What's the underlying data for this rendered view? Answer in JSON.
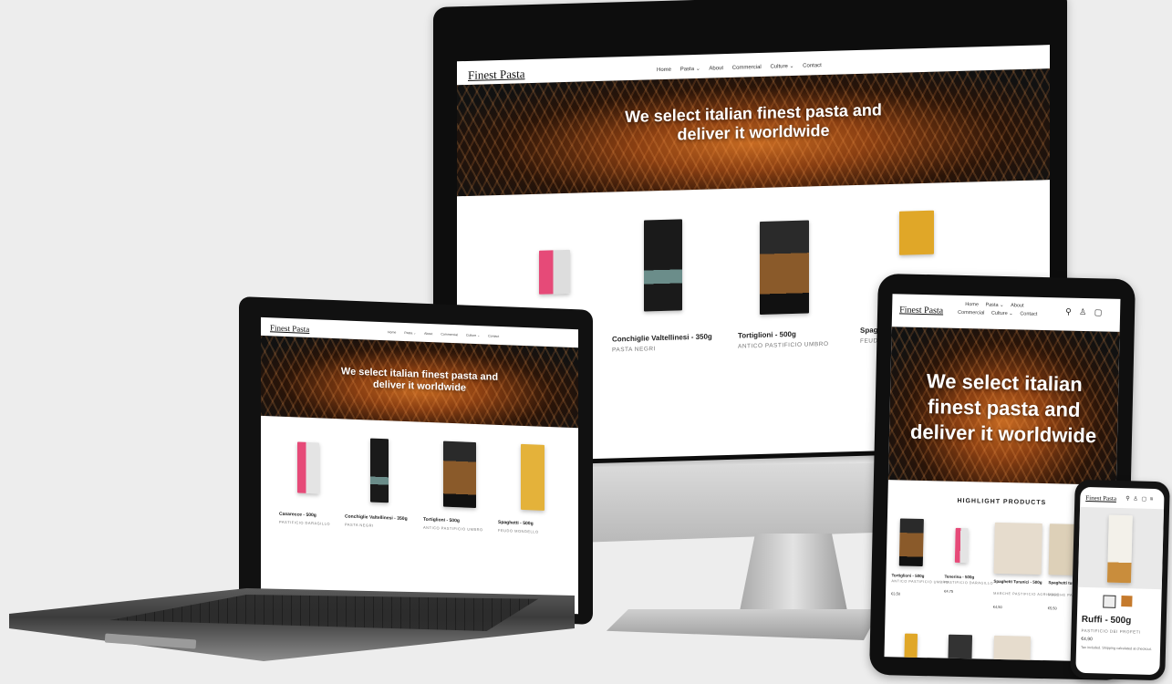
{
  "site": {
    "logo": "Finest Pasta",
    "nav": [
      "Home",
      "Pasta ⌄",
      "About",
      "Commercial",
      "Culture ⌄",
      "Contact"
    ],
    "icons": [
      "search-icon",
      "account-icon",
      "cart-icon",
      "menu-icon"
    ],
    "hero_text": "We select italian finest pasta and deliver it worldwide",
    "hero_lines": [
      "We select italian finest pasta and",
      "deliver it worldwide"
    ],
    "tablet_hero_lines": [
      "We select italian",
      "finest pasta and",
      "deliver it worldwide"
    ]
  },
  "desktop": {
    "products": [
      {
        "title": "Conchiglie Valtellinesi - 350g",
        "brand": "PASTA NEGRI"
      },
      {
        "title": "Tortiglioni - 500g",
        "brand": "ANTICO PASTIFICIO UMBRO"
      },
      {
        "title": "Spaghe",
        "brand": "FEUDO"
      }
    ]
  },
  "laptop": {
    "products": [
      {
        "title": "Casarecce - 500g",
        "brand": "PASTIFICIO DARAGILLO"
      },
      {
        "title": "Conchiglie Valtellinesi - 350g",
        "brand": "PASTA NEGRI"
      },
      {
        "title": "Tortiglioni - 500g",
        "brand": "ANTICO PASTIFICIO UMBRO"
      },
      {
        "title": "Spaghetti - 500g",
        "brand": "FEUDO MONDELLO"
      }
    ]
  },
  "tablet": {
    "nav_row1": [
      "Home",
      "Pasta ⌄",
      "About"
    ],
    "nav_row2": [
      "Commercial",
      "Culture ⌄",
      "Contact"
    ],
    "section_title": "HIGHLIGHT PRODUCTS",
    "products": [
      {
        "title": "Tortiglioni - 500g",
        "brand": "ANTICO PASTIFICIO UMBRO",
        "price": "€3,50"
      },
      {
        "title": "Tenerina - 500g",
        "brand": "PASTIFICIO DARAGILLO",
        "price": "€4,75"
      },
      {
        "title": "Spaghetti Turanici - 500g",
        "brand": "MARCHE PASTIFICIO AGRICOLO",
        "price": "€4,50"
      },
      {
        "title": "Spaghetti tur 500g",
        "brand": "MARCHE PAST AGRICOLO",
        "price": "€5,50"
      }
    ]
  },
  "phone": {
    "product_title": "Ruffi - 500g",
    "brand": "PASTIFICIO DEI PROFETI",
    "price": "€4,90",
    "tax_note": "Tax included. Shipping calculated at checkout."
  },
  "colors": {
    "background": "#ededed",
    "device_black": "#111111",
    "hero_orange": "#c66a22",
    "white": "#ffffff"
  }
}
